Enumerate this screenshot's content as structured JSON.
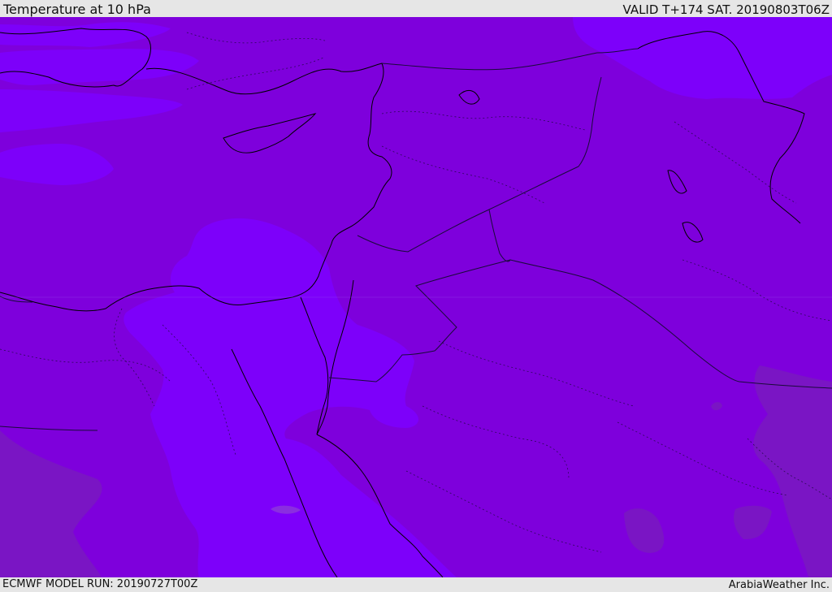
{
  "header": {
    "title": "Temperature at 10 hPa",
    "valid_time": "VALID T+174 SAT. 20190803T06Z"
  },
  "footer": {
    "model_run": "ECMWF MODEL RUN: 20190727T00Z",
    "credit": "ArabiaWeather Inc."
  },
  "map": {
    "colors": {
      "base_band": "#7e00dc",
      "light_band": "#7d00fa",
      "dark_band": "#7a15c4",
      "coast": "#000000",
      "border": "#1a0a3a"
    }
  }
}
